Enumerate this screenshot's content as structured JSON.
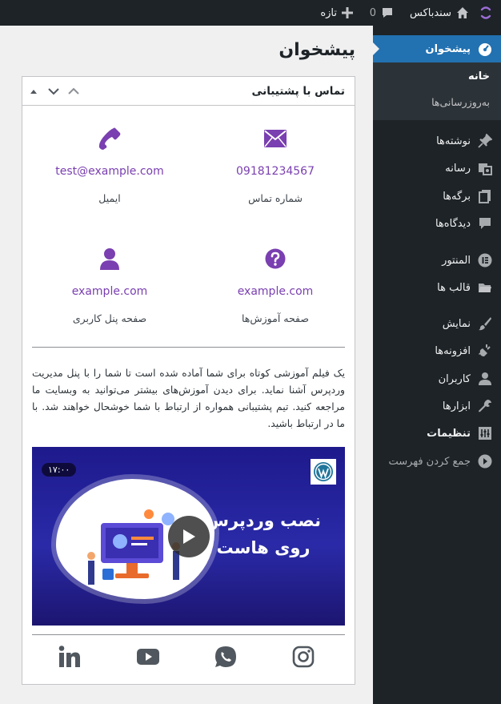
{
  "adminbar": {
    "site_name": "سندباکس",
    "comments_count": "0",
    "new_label": "تازه"
  },
  "sidebar": {
    "current": "پیشخوان",
    "submenu": [
      "خانه",
      "به‌روزرسانی‌ها"
    ],
    "items": [
      "نوشته‌ها",
      "رسانه",
      "برگه‌ها",
      "دیدگاه‌ها",
      "المنتور",
      "قالب ها",
      "نمایش",
      "افزونه‌ها",
      "کاربران",
      "ابزارها",
      "تنظیمات"
    ],
    "collapse": "جمع کردن فهرست"
  },
  "page": {
    "title": "پیشخوان"
  },
  "widget": {
    "title": "تماس با پشتیبانی",
    "contacts": [
      {
        "value": "09181234567",
        "label": "شماره تماس",
        "icon": "envelope-icon"
      },
      {
        "value": "test@example.com",
        "label": "ایمیل",
        "icon": "phone-icon"
      },
      {
        "value": "example.com",
        "label": "صفحه آموزش‌ها",
        "icon": "question-icon"
      },
      {
        "value": "example.com",
        "label": "صفحه پنل کاربری",
        "icon": "user-icon"
      }
    ],
    "description": "یک فیلم آموزشی کوتاه برای شما آماده شده است تا شما را با پنل مدیریت وردپرس آشنا نماید. برای دیدن آموزش‌های بیشتر می‌توانید به وبسایت ما مراجعه کنید. تیم پشتیبانی همواره از ارتباط با شما خوشحال خواهند شد. با ما در ارتباط باشید.",
    "video": {
      "title_line1": "نصب وردپرس",
      "title_line2": "روی هاست",
      "duration": "۱۷:۰۰"
    },
    "socials": [
      "instagram-icon",
      "whatsapp-icon",
      "youtube-icon",
      "linkedin-icon"
    ]
  },
  "colors": {
    "accent": "#2271b1",
    "sidebar_bg": "#1d2327",
    "link_purple": "#7a3fb0"
  }
}
